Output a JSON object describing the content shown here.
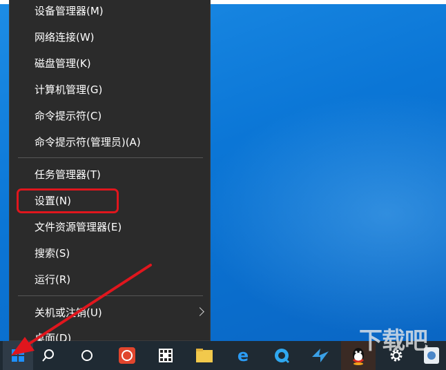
{
  "menu": {
    "items": [
      {
        "label": "设备管理器(M)"
      },
      {
        "label": "网络连接(W)"
      },
      {
        "label": "磁盘管理(K)"
      },
      {
        "label": "计算机管理(G)"
      },
      {
        "label": "命令提示符(C)"
      },
      {
        "label": "命令提示符(管理员)(A)"
      },
      {
        "label": "任务管理器(T)"
      },
      {
        "label": "设置(N)"
      },
      {
        "label": "文件资源管理器(E)"
      },
      {
        "label": "搜索(S)"
      },
      {
        "label": "运行(R)"
      },
      {
        "label": "关机或注销(U)"
      },
      {
        "label": "桌面(D)"
      }
    ]
  },
  "highlight_color": "#e0161d",
  "taskbar": {
    "icons": [
      "start-icon",
      "search-icon",
      "cortana-icon",
      "app-red-icon",
      "grid-app-icon",
      "folder-icon",
      "edge-icon",
      "browser-icon",
      "bird-app-icon",
      "qq-icon",
      "settings-icon",
      "media-icon"
    ]
  },
  "watermark": "下载吧"
}
